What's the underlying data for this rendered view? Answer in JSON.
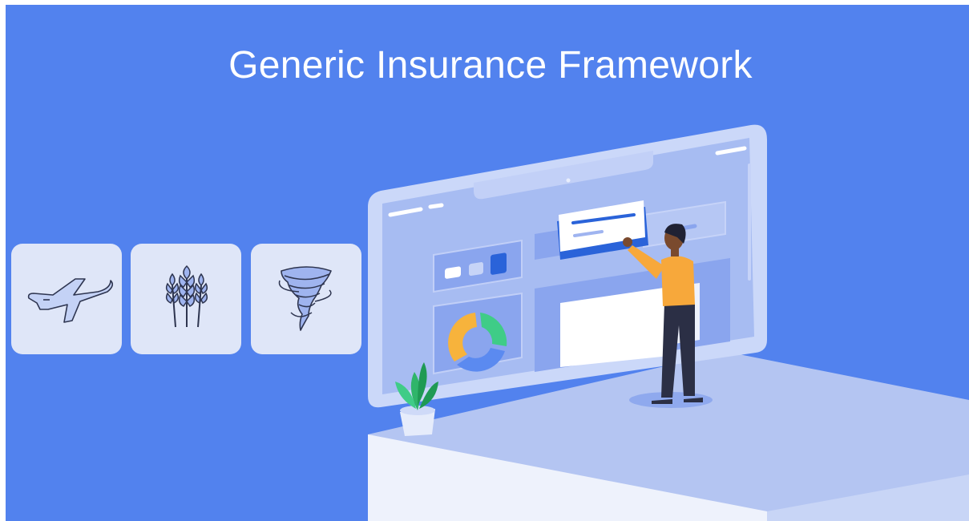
{
  "header": {
    "title": "Generic Insurance Framework"
  },
  "cards": [
    {
      "icon": "airplane-icon"
    },
    {
      "icon": "wheat-icon"
    },
    {
      "icon": "tornado-icon"
    }
  ],
  "colors": {
    "background": "#5282ee",
    "card": "#dfe6f8",
    "monitor_frame": "#c9d6f8",
    "screen": "#a8bdf3",
    "accent_blue": "#2a63d9",
    "person_shirt": "#f7a83b",
    "donut_yellow": "#f7b33c",
    "donut_green": "#3fcc87",
    "donut_blue": "#5b8af0",
    "plant_green": "#2fb56a"
  }
}
